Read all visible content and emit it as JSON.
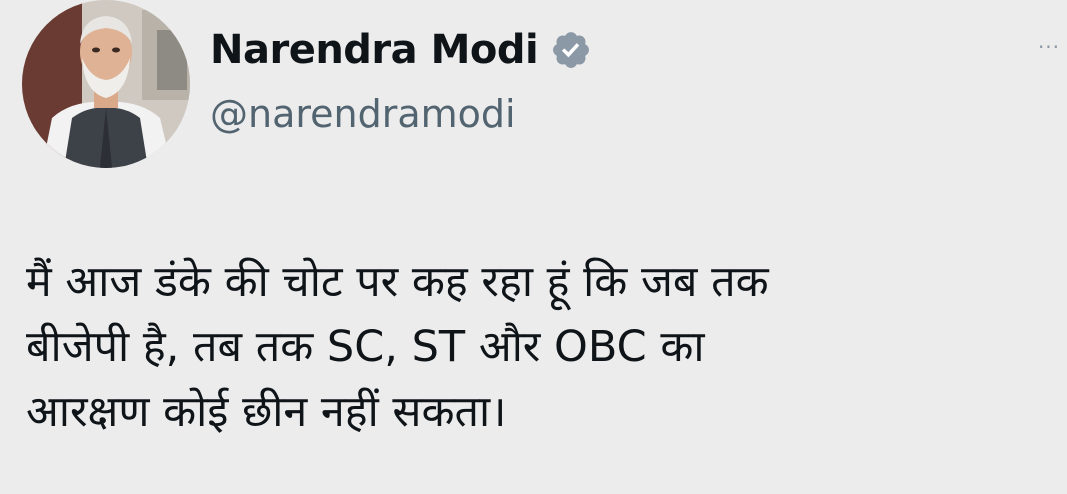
{
  "author": {
    "display_name": "Narendra Modi",
    "handle": "@narendramodi",
    "verified": true,
    "avatar_icon": "profile-photo",
    "verified_icon": "verified-badge-icon"
  },
  "more_menu": {
    "icon": "more-horizontal-icon",
    "glyph": "···"
  },
  "tweet": {
    "lines": [
      "मैं आज डंके की चोट पर कह रहा हूं कि जब तक",
      "बीजेपी है, तब तक SC, ST और OBC का",
      "आरक्षण कोई छीन नहीं सकता।"
    ]
  },
  "colors": {
    "background": "#ececec",
    "text": "#0f1419",
    "secondary": "#536471",
    "verified_badge": "#8b98a5"
  }
}
